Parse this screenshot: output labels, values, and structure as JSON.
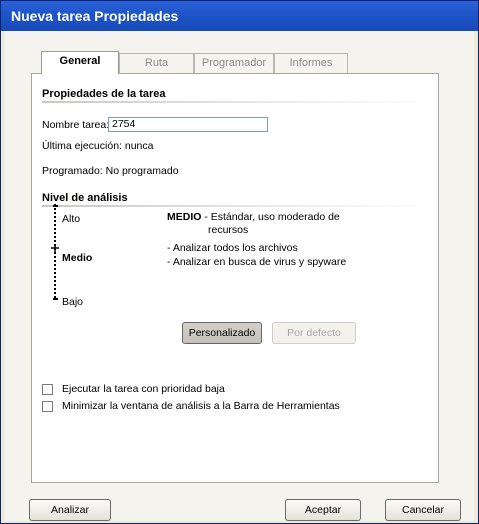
{
  "window": {
    "title": "Nueva tarea Propiedades"
  },
  "tabs": [
    "General",
    "Ruta",
    "Programador",
    "Informes"
  ],
  "task_props": {
    "header": "Propiedades de la tarea",
    "name_label": "Nombre tarea:",
    "name_value": "2754",
    "last_run": "Última ejecución: nunca",
    "scheduled": "Programado: No programado"
  },
  "scan_level": {
    "header": "Nivel de análisis",
    "levels": [
      "Alto",
      "Medio",
      "Bajo"
    ],
    "selected": "Medio",
    "desc_title": "MEDIO",
    "desc_line1": "- Estándar, uso moderado de",
    "desc_line2": "recursos",
    "bullet1": "- Analizar todos los archivos",
    "bullet2": "- Analizar en busca de virus y spyware",
    "custom_button": "Personalizado",
    "default_button": "Por defecto"
  },
  "options": [
    {
      "label": "Ejecutar la tarea con prioridad baja",
      "checked": false
    },
    {
      "label": "Minimizar la ventana de análisis a la Barra de Herramientas",
      "checked": false
    }
  ],
  "footer": {
    "analyze": "Analizar",
    "accept": "Aceptar",
    "cancel": "Cancelar"
  }
}
